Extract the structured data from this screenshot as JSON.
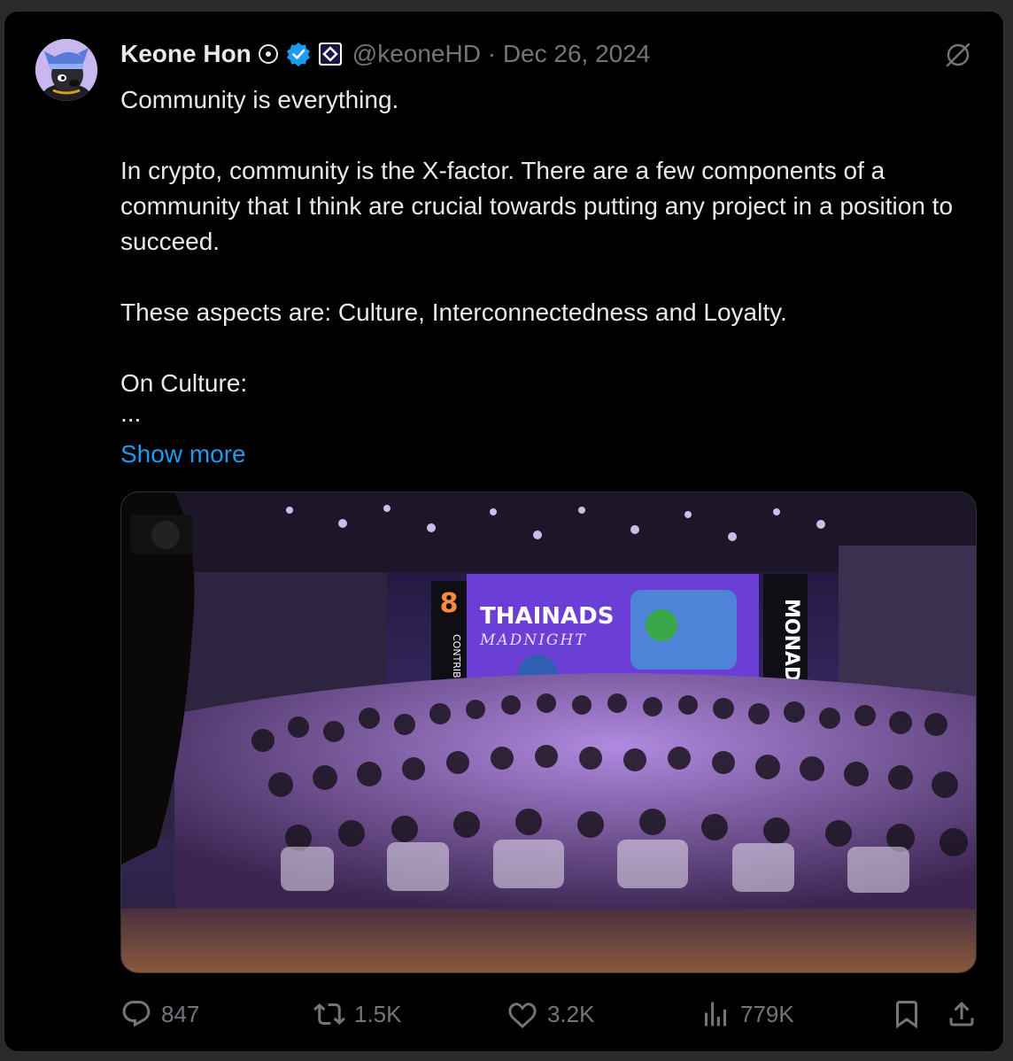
{
  "tweet": {
    "author_name": "Keone Hon",
    "handle_date": "@keoneHD · Dec 26, 2024",
    "paragraphs": [
      "Community is everything.",
      "",
      "In crypto, community is the X-factor. There are a few components of a community that I think are crucial towards putting any project in a position to succeed.",
      "",
      "These aspects are: Culture, Interconnectedness and Loyalty.",
      "",
      "On Culture:",
      "..."
    ],
    "show_more": "Show more"
  },
  "media": {
    "stage_title": "THAINADS",
    "stage_subtitle": "MADNIGHT",
    "left_banner": "CONTRIB DAO",
    "right_banner": "MONAD",
    "accent_color": "#6b3fd6"
  },
  "stats": {
    "replies": "847",
    "reposts": "1.5K",
    "likes": "3.2K",
    "views": "779K"
  },
  "icons": [
    "reply-icon",
    "repost-icon",
    "like-icon",
    "views-icon",
    "bookmark-icon",
    "share-icon",
    "grok-icon",
    "verified-icon"
  ]
}
